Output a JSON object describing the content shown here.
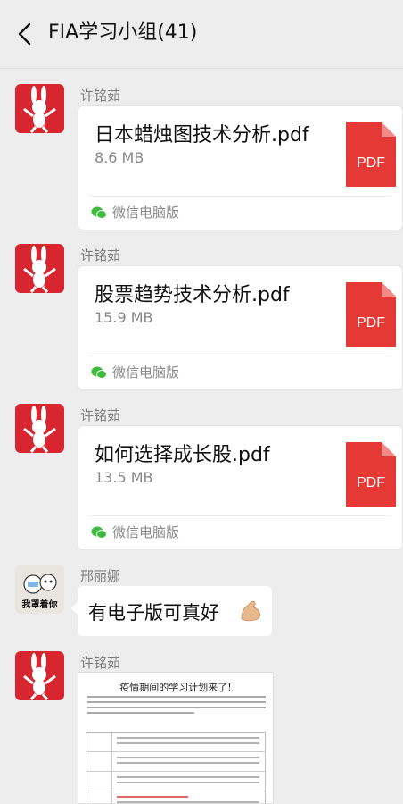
{
  "header": {
    "title": "FIA学习小组(41)"
  },
  "messages": [
    {
      "sender": "许铭茹",
      "file_name": "日本蜡烛图技术分析.pdf",
      "file_size": "8.6 MB",
      "file_icon": "PDF",
      "source": "微信电脑版"
    },
    {
      "sender": "许铭茹",
      "file_name": "股票趋势技术分析.pdf",
      "file_size": "15.9 MB",
      "file_icon": "PDF",
      "source": "微信电脑版"
    },
    {
      "sender": "许铭茹",
      "file_name": "如何选择成长股.pdf",
      "file_size": "13.5 MB",
      "file_icon": "PDF",
      "source": "微信电脑版"
    },
    {
      "sender": "邢丽娜",
      "avatar_caption": "我罩着你",
      "text": "有电子版可真好",
      "emoji": "flexed-biceps"
    },
    {
      "sender": "许铭茹",
      "image_title": "疫情期间的学习计划来了!"
    }
  ],
  "colors": {
    "pdf_red": "#e53935",
    "avatar_red": "#d7262f",
    "wechat_green": "#3dbb3c"
  }
}
